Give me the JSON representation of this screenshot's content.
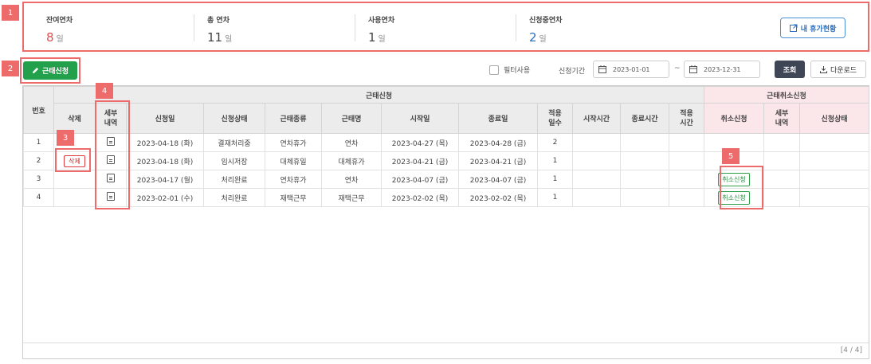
{
  "markers": [
    "1",
    "2",
    "3",
    "4",
    "5"
  ],
  "summary": {
    "remaining": {
      "label": "잔여연차",
      "value": "8",
      "unit": "일",
      "color": "#e05050"
    },
    "total": {
      "label": "총 연차",
      "value": "11",
      "unit": "일"
    },
    "used": {
      "label": "사용연차",
      "value": "1",
      "unit": "일"
    },
    "pending": {
      "label": "신청중연차",
      "value": "2",
      "unit": "일",
      "color": "#2b6fc0"
    },
    "my_leave_button": "내 휴가현황"
  },
  "toolbar": {
    "apply_button": "근태신청",
    "filter_label": "필터사용",
    "period_label": "신청기간",
    "date_from": "2023-01-01",
    "date_separator": "~",
    "date_to": "2023-12-31",
    "search_button": "조회",
    "download_button": "다운로드"
  },
  "table": {
    "group_apply": "근태신청",
    "group_cancel": "근태취소신청",
    "headers": {
      "no": "번호",
      "delete": "삭제",
      "detail": "세부\n내역",
      "apply_date": "신청일",
      "status": "신청상태",
      "type": "근태종류",
      "name": "근태명",
      "start": "시작일",
      "end": "종료일",
      "days": "적용\n일수",
      "start_time": "시작시간",
      "end_time": "종료시간",
      "applied_time": "적용\n시간",
      "cancel_apply": "취소신청",
      "cancel_detail": "세부\n내역",
      "cancel_status": "신청상태"
    },
    "delete_label": "삭제",
    "cancel_label": "취소신청",
    "rows": [
      {
        "no": "1",
        "apply_date": "2023-04-18 (화)",
        "status": "결재처리중",
        "type": "연차휴가",
        "name": "연차",
        "start": "2023-04-27 (목)",
        "end": "2023-04-28 (금)",
        "days": "2",
        "deletable": false,
        "cancelable": false
      },
      {
        "no": "2",
        "apply_date": "2023-04-18 (화)",
        "status": "임시저장",
        "type": "대체휴일",
        "name": "대체휴가",
        "start": "2023-04-21 (금)",
        "end": "2023-04-21 (금)",
        "days": "1",
        "deletable": true,
        "cancelable": false
      },
      {
        "no": "3",
        "apply_date": "2023-04-17 (월)",
        "status": "처리완료",
        "type": "연차휴가",
        "name": "연차",
        "start": "2023-04-07 (금)",
        "end": "2023-04-07 (금)",
        "days": "1",
        "deletable": false,
        "cancelable": true
      },
      {
        "no": "4",
        "apply_date": "2023-02-01 (수)",
        "status": "처리완료",
        "type": "재택근무",
        "name": "재택근무",
        "start": "2023-02-02 (목)",
        "end": "2023-02-02 (목)",
        "days": "1",
        "deletable": false,
        "cancelable": true
      }
    ],
    "pager": "[4 / 4]"
  }
}
